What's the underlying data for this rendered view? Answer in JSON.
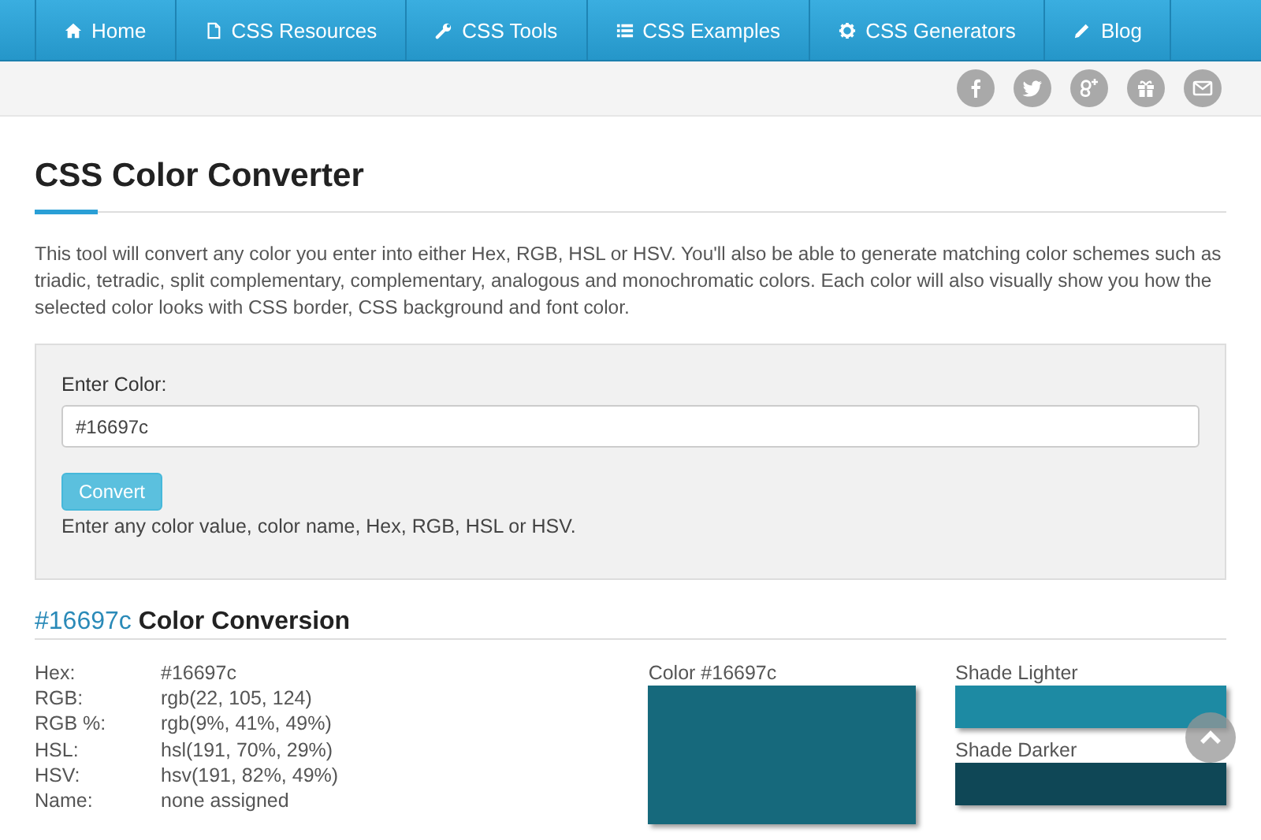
{
  "nav": [
    {
      "label": "Home",
      "selected": false
    },
    {
      "label": "CSS Resources",
      "selected": false
    },
    {
      "label": "CSS Tools",
      "selected": false
    },
    {
      "label": "CSS Examples",
      "selected": false
    },
    {
      "label": "CSS Generators",
      "selected": false
    },
    {
      "label": "Blog",
      "selected": false
    }
  ],
  "title": "CSS Color Converter",
  "intro": "This tool will convert any color you enter into either Hex, RGB, HSL or HSV. You'll also be able to generate matching color schemes such as triadic, tetradic, split complementary, complementary, analogous and monochromatic colors. Each color will also visually show you how the selected color looks with CSS border, CSS background and font color.",
  "form": {
    "label": "Enter Color:",
    "value": "#16697c",
    "button": "Convert",
    "help": "Enter any color value, color name, Hex, RGB, HSL or HSV."
  },
  "result": {
    "hex": "#16697c",
    "heading": "Color Conversion",
    "rows": [
      {
        "label": "Hex:",
        "value": "#16697c"
      },
      {
        "label": "RGB:",
        "value": "rgb(22, 105, 124)"
      },
      {
        "label": "RGB %:",
        "value": "rgb(9%, 41%, 49%)"
      },
      {
        "label": "HSL:",
        "value": "hsl(191, 70%, 29%)"
      },
      {
        "label": "HSV:",
        "value": "hsv(191, 82%, 49%)"
      },
      {
        "label": "Name:",
        "value": "none assigned"
      }
    ],
    "main": {
      "label": "Color #16697c",
      "color": "#16697c"
    },
    "shades": [
      {
        "label": "Shade Lighter",
        "color": "#1d8aa3"
      },
      {
        "label": "Shade Darker",
        "color": "#0f4756"
      }
    ]
  }
}
